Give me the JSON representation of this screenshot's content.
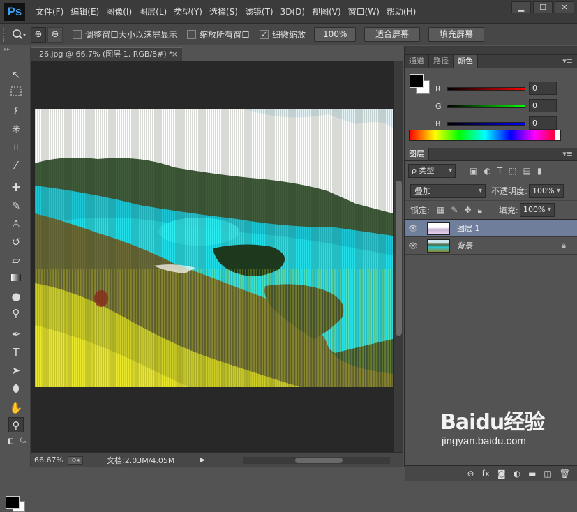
{
  "app": {
    "logo": "Ps"
  },
  "menu": [
    "文件(F)",
    "编辑(E)",
    "图像(I)",
    "图层(L)",
    "类型(Y)",
    "选择(S)",
    "滤镜(T)",
    "3D(D)",
    "视图(V)",
    "窗口(W)",
    "帮助(H)"
  ],
  "window_buttons": {
    "minimize": "▁",
    "maximize": "☐",
    "close": "✕"
  },
  "options": {
    "resize_window": "调整窗口大小以满屏显示",
    "zoom_all": "缩放所有窗口",
    "scrubby_zoom": "细微缩放",
    "btn_100": "100%",
    "btn_fit": "适合屏幕",
    "btn_fill": "填充屏幕"
  },
  "document": {
    "tab_title": "26.jpg @ 66.7% (图层 1, RGB/8#) *",
    "close": "×"
  },
  "status": {
    "zoom": "66.67%",
    "doc_size": "文档:2.03M/4.05M"
  },
  "panels": {
    "top_tabs": [
      "通道",
      "路径",
      "颜色"
    ],
    "active_top_tab": "颜色",
    "color": {
      "r_label": "R",
      "g_label": "G",
      "b_label": "B",
      "r": "0",
      "g": "0",
      "b": "0",
      "fg": "#000000",
      "bg": "#ffffff"
    },
    "layers_tab": "图层",
    "layers": {
      "filter": "ρ 类型",
      "blend_mode": "叠加",
      "opacity_label": "不透明度:",
      "opacity": "100%",
      "lock_label": "锁定:",
      "fill_label": "填充:",
      "fill": "100%",
      "items": [
        {
          "name": "图层 1",
          "selected": true
        },
        {
          "name": "背景",
          "selected": false,
          "locked": true
        }
      ]
    }
  },
  "watermark": {
    "text": "Baidu经验",
    "url": "jingyan.baidu.com"
  },
  "colors": {
    "selected_layer": "#6f7e9a",
    "chrome_dark": "#3b3b3b",
    "canvas_bg": "#282828",
    "logo_blue": "#3d9df3"
  }
}
